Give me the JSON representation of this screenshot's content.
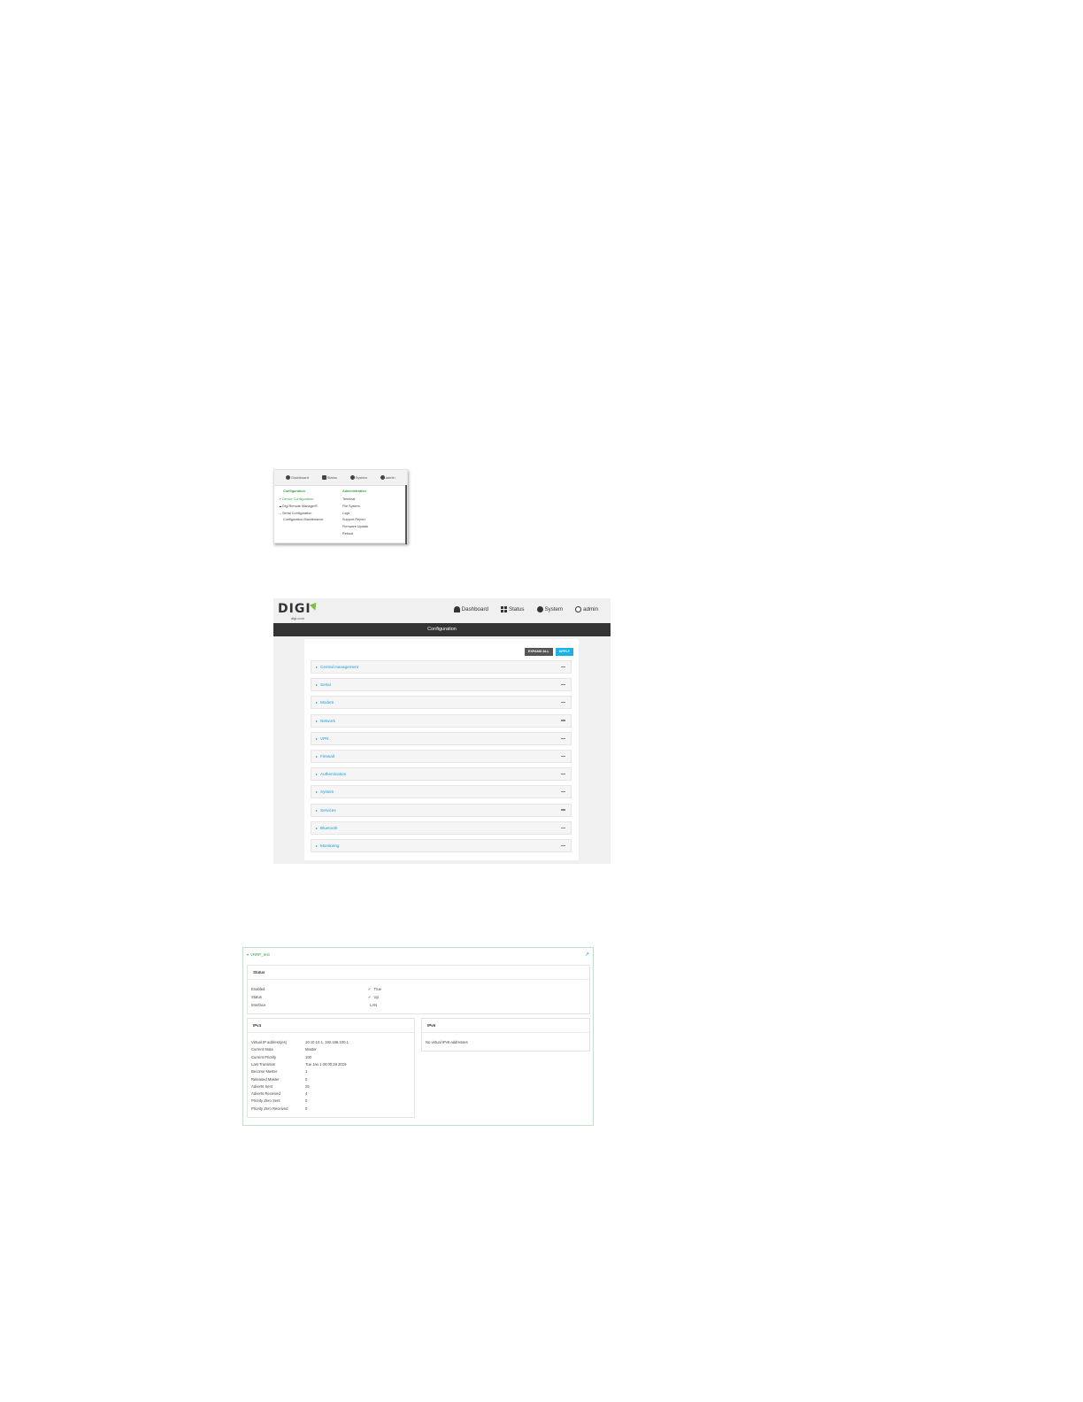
{
  "menu_shot": {
    "nav": [
      "Dashboard",
      "Status",
      "System",
      "admin"
    ],
    "configuration_heading": "Configuration",
    "configuration_items": [
      "Device Configuration",
      "Digi Remote Manager®",
      "Serial Configuration",
      "Configuration Maintenance"
    ],
    "administration_heading": "Administration",
    "administration_items": [
      "Terminal",
      "File System",
      "Logs",
      "Support Report",
      "Firmware Update",
      "Reboot"
    ]
  },
  "config_shot": {
    "logo_text": "DIGI",
    "logo_sub": "digi.com",
    "nav": {
      "dashboard": "Dashboard",
      "status": "Status",
      "system": "System",
      "admin": "admin"
    },
    "page_title": "Configuration",
    "expand_all": "EXPAND ALL",
    "apply": "APPLY",
    "sections": [
      "Central management",
      "Serial",
      "Modem",
      "Network",
      "VPN",
      "Firewall",
      "Authentication",
      "System",
      "Services",
      "Bluetooth",
      "Monitoring"
    ]
  },
  "vrrp_shot": {
    "instance": "VRRP_test",
    "status_title": "Status",
    "status_rows": [
      {
        "label": "Enabled",
        "value": "True",
        "check": true
      },
      {
        "label": "Status",
        "value": "Up",
        "check": true
      },
      {
        "label": "Interface",
        "value": "LAN",
        "check": false
      }
    ],
    "ipv4_title": "IPv4",
    "ipv4_rows": [
      {
        "label": "Virtual IP address(es)",
        "value": "10.10.10.1, 192.168.100.1"
      },
      {
        "label": "Current State",
        "value": "Master"
      },
      {
        "label": "Current Priority",
        "value": "100"
      },
      {
        "label": "Last Transition",
        "value": "Tue Jan 1 00:00:28 2019"
      },
      {
        "label": "Become Master",
        "value": "1"
      },
      {
        "label": "Released Master",
        "value": "0"
      },
      {
        "label": "Adverts Sent",
        "value": "25"
      },
      {
        "label": "Adverts Received",
        "value": "4"
      },
      {
        "label": "Priority Zero Sent",
        "value": "0"
      },
      {
        "label": "Priority Zero Received",
        "value": "0"
      }
    ],
    "ipv6_title": "IPv6",
    "ipv6_message": "No virtual IPv6 addresses"
  }
}
